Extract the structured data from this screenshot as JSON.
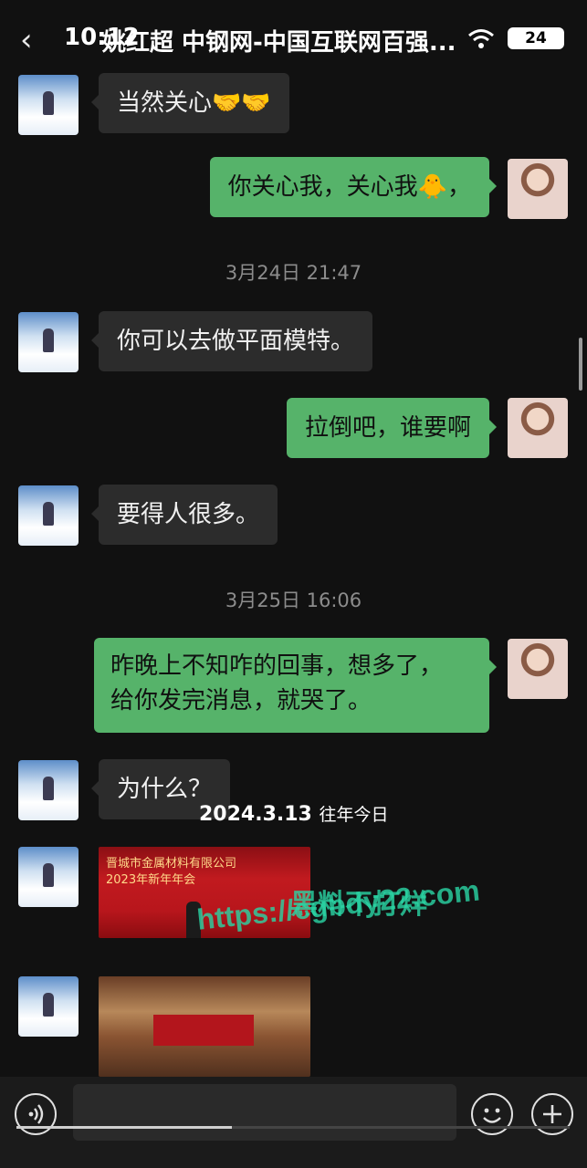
{
  "status": {
    "time": "10:12",
    "battery": "24"
  },
  "header": {
    "title": "姚红超 中钢网-中国互联网百强..."
  },
  "stamps": [
    "3月24日 21:47",
    "3月25日 16:06"
  ],
  "messages": [
    {
      "side": "left",
      "text": "当然关心",
      "emoji": "🤝🤝"
    },
    {
      "side": "right",
      "text": "你关心我，关心我",
      "emoji": "🐥",
      "tail": "，"
    },
    {
      "side": "left",
      "text": "你可以去做平面模特。"
    },
    {
      "side": "right",
      "text": "拉倒吧，谁要啊"
    },
    {
      "side": "left",
      "text": "要得人很多。"
    },
    {
      "side": "right",
      "line1": "昨晚上不知咋的回事，想多了，",
      "line2": "给你发完消息，就哭了。"
    },
    {
      "side": "left",
      "text": "为什么？"
    }
  ],
  "photo1": {
    "banner_line1": "晋城市金属材料有限公司",
    "banner_line2": "2023年新年年会"
  },
  "overlay": {
    "date": "2024.3.13",
    "label": "往年今日"
  },
  "watermark": {
    "line1": "黑料不打烊",
    "line2": "https://cgbdy22.com"
  },
  "icons": [
    "back-icon",
    "wifi-icon",
    "battery-icon",
    "voice-icon",
    "emoji-icon",
    "plus-icon"
  ],
  "video_progress": 0.39
}
